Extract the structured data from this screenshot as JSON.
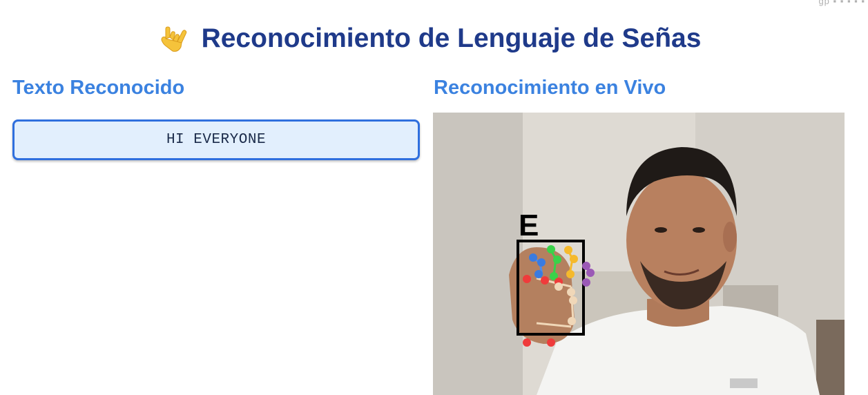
{
  "page": {
    "title": "Reconocimiento de Lenguaje de Señas",
    "title_icon": "love-you-hand-icon"
  },
  "left_panel": {
    "heading": "Texto Reconocido",
    "recognized_text": "HI EVERYONE"
  },
  "right_panel": {
    "heading": "Reconocimiento en Vivo",
    "video": {
      "detected_letter": "E"
    }
  },
  "colors": {
    "title": "#1f3a8a",
    "heading": "#3b82e0",
    "text_box_border": "#2f6fde",
    "text_box_bg": "#e2effd"
  }
}
